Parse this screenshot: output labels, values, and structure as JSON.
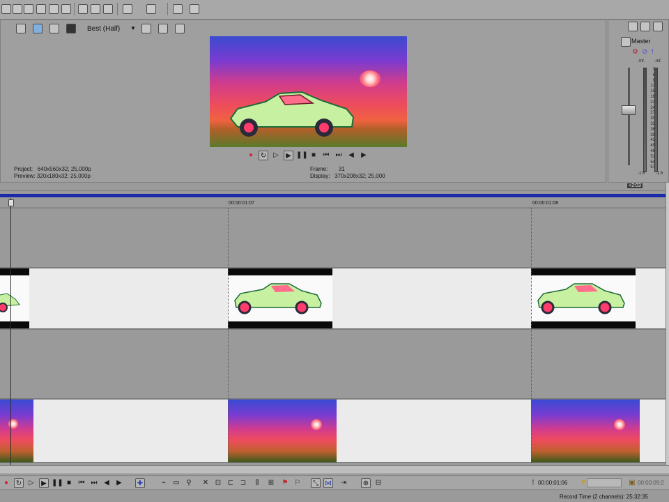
{
  "preview": {
    "quality": "Best (Half)",
    "project_label": "Project:",
    "project_value": "640x560x32; 25,000p",
    "preview_label": "Preview:",
    "preview_value": "320x180x32; 25,000p",
    "frame_label": "Frame:",
    "frame_value": "31",
    "display_label": "Display:",
    "display_value": "370x208x32; 25,000"
  },
  "master": {
    "title": "Master",
    "left_inf": "-Inf.",
    "right_inf": "-Inf.",
    "scale": [
      "3",
      "6",
      "9",
      "12",
      "15",
      "18",
      "21",
      "24",
      "27",
      "30",
      "33",
      "36",
      "39",
      "42",
      "45",
      "48",
      "51",
      "54",
      "57"
    ],
    "left_bottom": "-1.5",
    "right_bottom": "-1.5"
  },
  "timeline": {
    "timecode_badge": "+2:03",
    "ruler_labels": [
      "00:00:01:07",
      "00:00:01:08"
    ]
  },
  "transport_bottom": {
    "cursor_time": "00:00:01:06",
    "end_time": "00:00:09:2"
  },
  "status": {
    "record_time": "Record Time (2 channels): 25:32:35"
  },
  "colors": {
    "timeline_blue": "#1a2aa8",
    "record_red": "#d0283a"
  }
}
